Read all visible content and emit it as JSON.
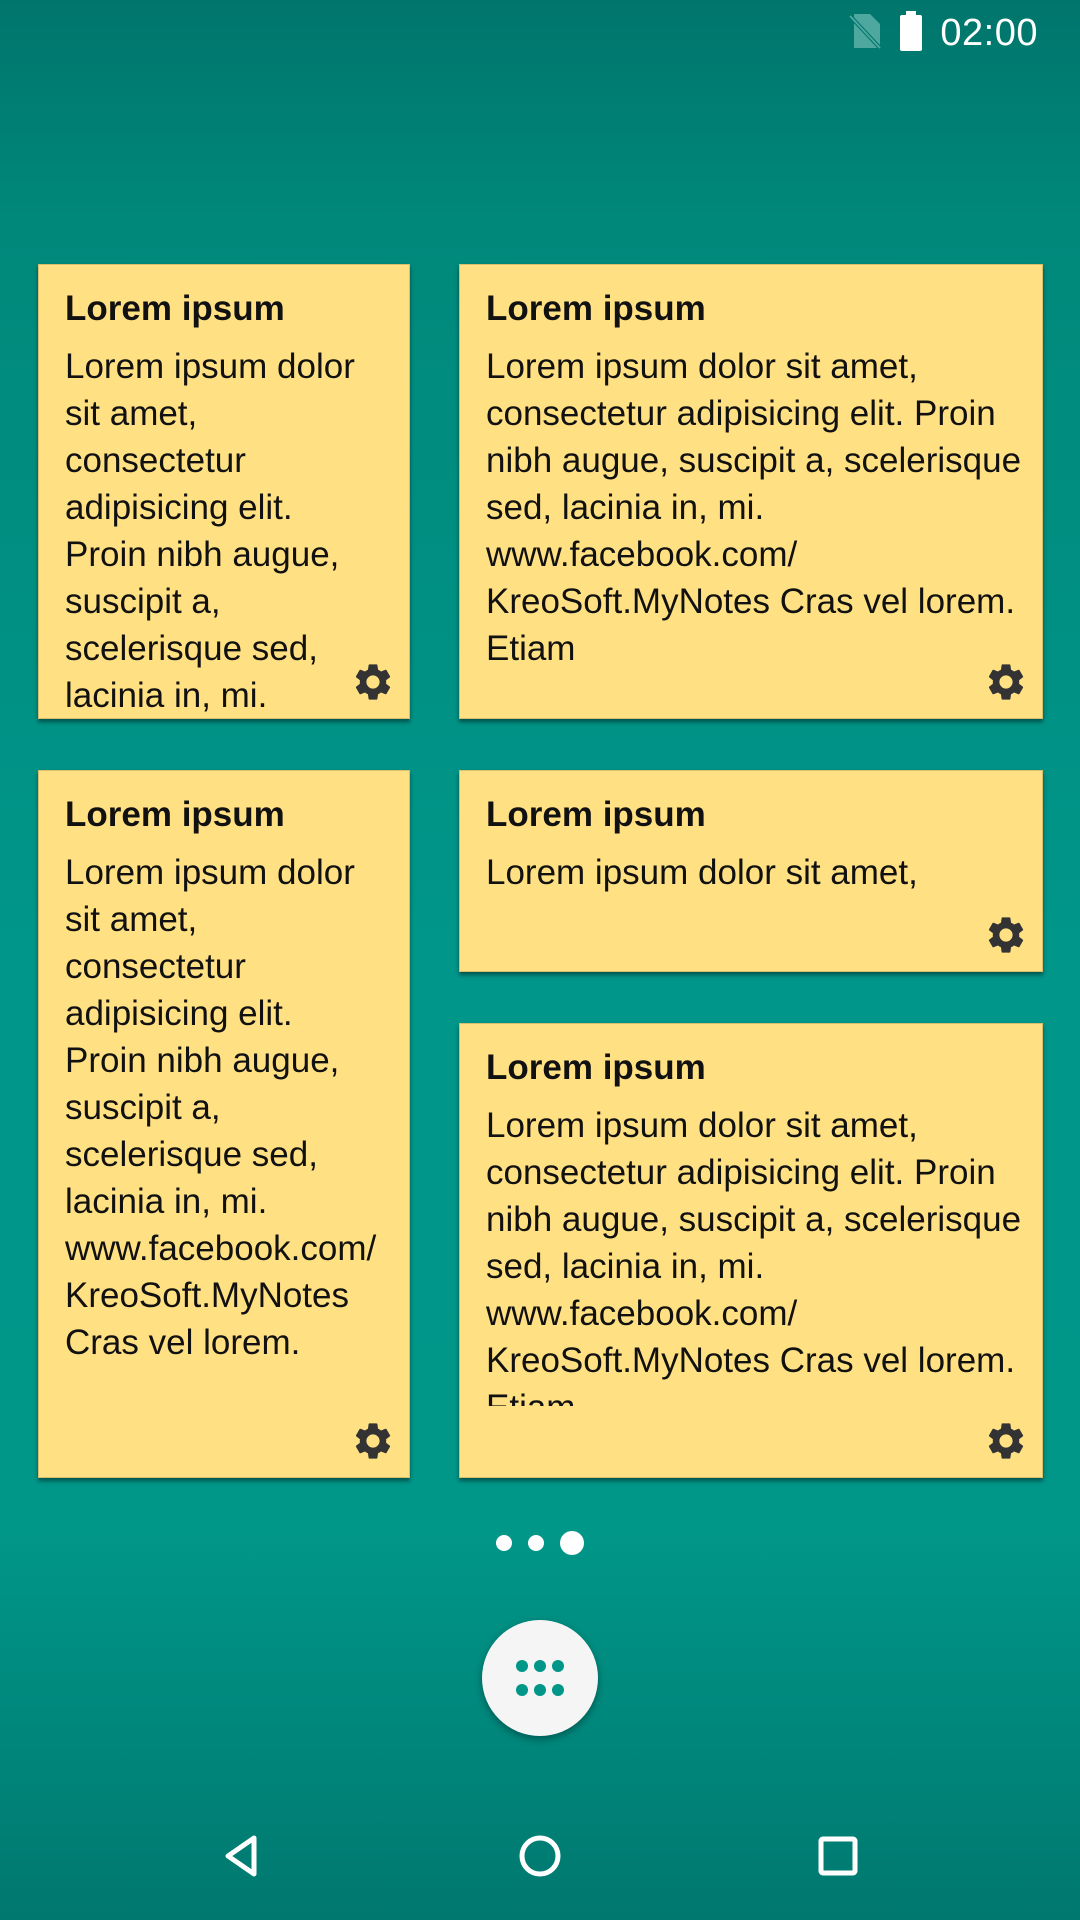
{
  "status_bar": {
    "time": "02:00",
    "icons": [
      "no-sim-icon",
      "battery-full-icon"
    ]
  },
  "notes": [
    {
      "title": "Lorem ipsum",
      "body": "Lorem ipsum dolor sit amet, consectetur adipisicing elit. Proin nibh augue, suscipit a, scelerisque sed, lacinia in, mi. www.facebook.com/ KreoSoft.MyNotes Cras vel lorem. Etiam"
    },
    {
      "title": "Lorem ipsum",
      "body": "Lorem ipsum dolor sit amet, consectetur adipisicing elit. Proin nibh augue, suscipit a, scelerisque sed, lacinia in, mi. www.facebook.com/ KreoSoft.MyNotes Cras vel lorem. Etiam"
    },
    {
      "title": "Lorem ipsum",
      "body": "Lorem ipsum dolor sit amet, consectetur adipisicing elit. Proin nibh augue, suscipit a, scelerisque sed, lacinia in, mi. www.facebook.com/ KreoSoft.MyNotes Cras vel lorem."
    },
    {
      "title": "Lorem ipsum",
      "body": "Lorem ipsum dolor sit amet,"
    },
    {
      "title": "Lorem ipsum",
      "body": "Lorem ipsum dolor sit amet, consectetur adipisicing elit. Proin nibh augue, suscipit a, scelerisque sed, lacinia in, mi. www.facebook.com/ KreoSoft.MyNotes Cras vel lorem. Etiam"
    }
  ],
  "pager": {
    "page_count": 3,
    "current_page": 3
  },
  "dock": {
    "app_drawer_icon": "app-drawer-icon"
  },
  "nav_bar": {
    "icons": [
      "back-icon",
      "home-icon",
      "recents-icon"
    ]
  },
  "colors": {
    "background": "#009688",
    "note": "#ffe082",
    "gear": "#333333"
  }
}
